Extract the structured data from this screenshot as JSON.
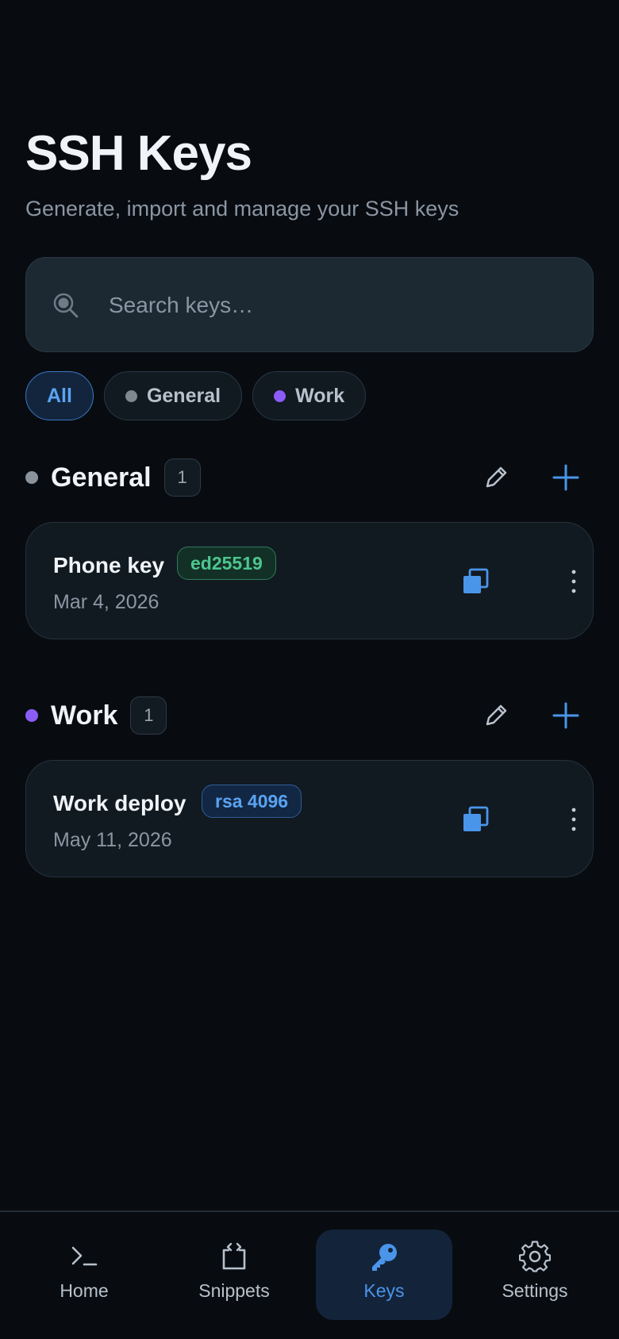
{
  "header": {
    "title": "SSH Keys",
    "subtitle": "Generate, import and manage your SSH keys"
  },
  "search": {
    "placeholder": "Search keys…",
    "value": "",
    "icon": "search-icon"
  },
  "filters": [
    {
      "label": "All",
      "active": true
    },
    {
      "label": "General",
      "dot_color": "#7f8891",
      "active": false
    },
    {
      "label": "Work",
      "dot_color": "#8b5cf6",
      "active": false
    }
  ],
  "groups": [
    {
      "name": "General",
      "dot_color": "#8a939c",
      "count": "1",
      "keys": [
        {
          "name": "Phone key",
          "type": "ed25519",
          "badge_color": "#4cc68e",
          "date": "Mar 4, 2026"
        }
      ]
    },
    {
      "name": "Work",
      "dot_color": "#8b5cf6",
      "count": "1",
      "keys": [
        {
          "name": "Work deploy",
          "type": "rsa 4096",
          "badge_color": "#5aa3f2",
          "date": "May 11, 2026"
        }
      ]
    }
  ],
  "tabs": [
    {
      "label": "Home",
      "icon": "terminal-icon",
      "active": false
    },
    {
      "label": "Snippets",
      "icon": "code-snippet-icon",
      "active": false
    },
    {
      "label": "Keys",
      "icon": "key-icon",
      "active": true
    },
    {
      "label": "Settings",
      "icon": "gear-icon",
      "active": false
    }
  ],
  "colors": {
    "accent": "#4a95ea",
    "background": "#080c11",
    "card": "#111921"
  }
}
